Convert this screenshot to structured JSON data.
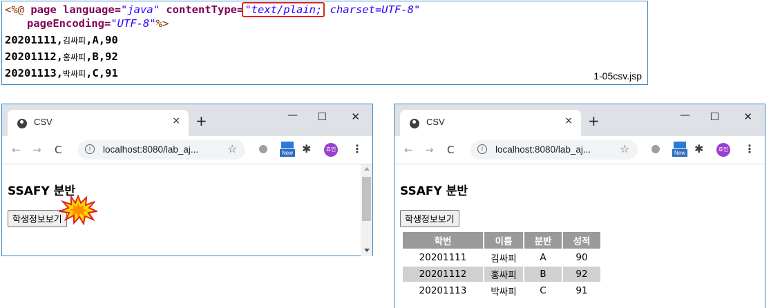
{
  "code": {
    "line1": {
      "open": "<%@ ",
      "kw_page": "page ",
      "attr_language": "language=",
      "val_language": "\"java\"",
      "attr_ct": " contentType=",
      "val_ct_hl": "\"text/plain;",
      "val_ct_rest": " charset=UTF-8\""
    },
    "line2": {
      "attr_pe": "pageEncoding=",
      "val_pe": "\"UTF-8\"",
      "close": "%>"
    },
    "rows": [
      {
        "id": "20201111",
        "name": "김싸피",
        "rest": ",A,90"
      },
      {
        "id": "20201112",
        "name": "홍싸피",
        "rest": ",B,92"
      },
      {
        "id": "20201113",
        "name": "박싸피",
        "rest": ",C,91"
      }
    ],
    "file_label": "1-05csv.jsp"
  },
  "browser": {
    "tab_title": "CSV",
    "tab_close": "×",
    "new_tab": "+",
    "minimize": "—",
    "maximize": "☐",
    "close": "✕",
    "back": "←",
    "forward": "→",
    "reload": "C",
    "url": "localhost:8080/lab_aj...",
    "star": "☆",
    "new_badge": "New",
    "avatar_label": "효인",
    "menu": "⋮",
    "heading": "SSAFY 분반",
    "button_label": "학생정보보기"
  },
  "table": {
    "headers": [
      "학번",
      "이름",
      "분반",
      "성적"
    ],
    "rows": [
      [
        "20201111",
        "김싸피",
        "A",
        "90"
      ],
      [
        "20201112",
        "홍싸피",
        "B",
        "92"
      ],
      [
        "20201113",
        "박싸피",
        "C",
        "91"
      ]
    ]
  },
  "icons": {
    "site": "globe-icon",
    "info": "info-icon",
    "extension": "puzzle-icon",
    "burst": "click-burst-icon"
  },
  "colors": {
    "border": "#3d87c7",
    "highlight": "#e0241b",
    "table_header": "#9a9a9a",
    "table_shade": "#d0d0d0",
    "avatar": "#9b3fd1"
  }
}
